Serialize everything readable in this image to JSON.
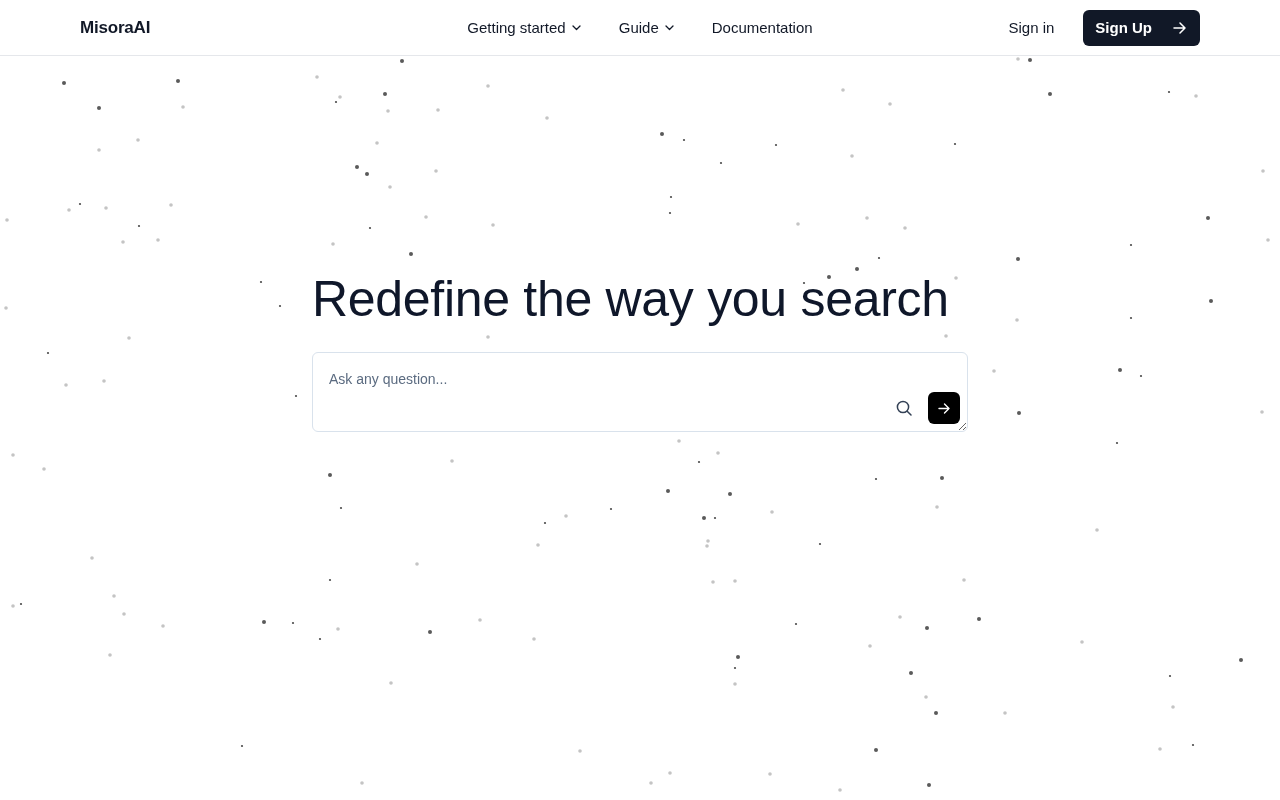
{
  "header": {
    "logo": "MisoraAI",
    "nav": [
      {
        "label": "Getting started",
        "kind": "dropdown"
      },
      {
        "label": "Guide",
        "kind": "dropdown"
      },
      {
        "label": "Documentation",
        "kind": "link"
      }
    ],
    "sign_in": "Sign in",
    "sign_up": "Sign Up"
  },
  "hero": {
    "headline": "Redefine the way you search",
    "search": {
      "placeholder": "Ask any question..."
    }
  }
}
